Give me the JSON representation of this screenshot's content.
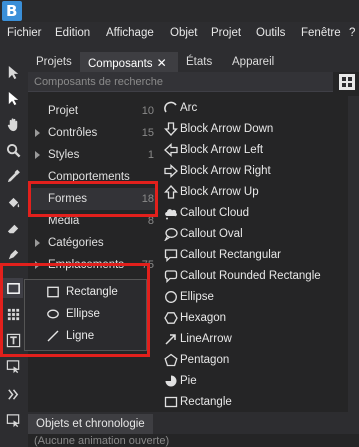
{
  "app": {
    "logo_letter": "B"
  },
  "menubar": {
    "items": [
      "Fichier",
      "Edition",
      "Affichage",
      "Objet",
      "Projet",
      "Outils",
      "Fenêtre",
      "?"
    ]
  },
  "panel": {
    "tabs": [
      {
        "label": "Projets"
      },
      {
        "label": "Composants",
        "close": "✕"
      },
      {
        "label": "États"
      },
      {
        "label": "Appareil"
      }
    ],
    "search_placeholder": "Composants de recherche",
    "categories": [
      {
        "label": "Projet",
        "count": "10",
        "expandable": false
      },
      {
        "label": "Contrôles",
        "count": "15",
        "expandable": true
      },
      {
        "label": "Styles",
        "count": "1",
        "expandable": true
      },
      {
        "label": "Comportements",
        "count": "",
        "expandable": false
      },
      {
        "label": "Formes",
        "count": "18",
        "expandable": false
      },
      {
        "label": "Média",
        "count": "8",
        "expandable": false
      },
      {
        "label": "Catégories",
        "count": "",
        "expandable": true
      },
      {
        "label": "Emplacements",
        "count": "75",
        "expandable": true
      }
    ],
    "shapes": [
      {
        "label": "Arc",
        "icon": "arc-icon"
      },
      {
        "label": "Block Arrow Down",
        "icon": "block-arrow-down-icon"
      },
      {
        "label": "Block Arrow Left",
        "icon": "block-arrow-left-icon"
      },
      {
        "label": "Block Arrow Right",
        "icon": "block-arrow-right-icon"
      },
      {
        "label": "Block Arrow Up",
        "icon": "block-arrow-up-icon"
      },
      {
        "label": "Callout Cloud",
        "icon": "callout-cloud-icon"
      },
      {
        "label": "Callout Oval",
        "icon": "callout-oval-icon"
      },
      {
        "label": "Callout Rectangular",
        "icon": "callout-rectangular-icon"
      },
      {
        "label": "Callout Rounded Rectangle",
        "icon": "callout-rounded-rectangle-icon"
      },
      {
        "label": "Ellipse",
        "icon": "ellipse-icon"
      },
      {
        "label": "Hexagon",
        "icon": "hexagon-icon"
      },
      {
        "label": "LineArrow",
        "icon": "line-arrow-icon"
      },
      {
        "label": "Pentagon",
        "icon": "pentagon-icon"
      },
      {
        "label": "Pie",
        "icon": "pie-icon"
      },
      {
        "label": "Rectangle",
        "icon": "rectangle-icon"
      }
    ]
  },
  "shape_popup": {
    "items": [
      {
        "label": "Rectangle",
        "icon": "rectangle-icon"
      },
      {
        "label": "Ellipse",
        "icon": "ellipse-icon"
      },
      {
        "label": "Ligne",
        "icon": "line-icon"
      }
    ]
  },
  "bottom_panel": {
    "tab": "Objets et chronologie",
    "status": "(Aucune animation ouverte)"
  },
  "colors": {
    "highlight": "#e2201c",
    "accent": "#3a8fd8"
  }
}
